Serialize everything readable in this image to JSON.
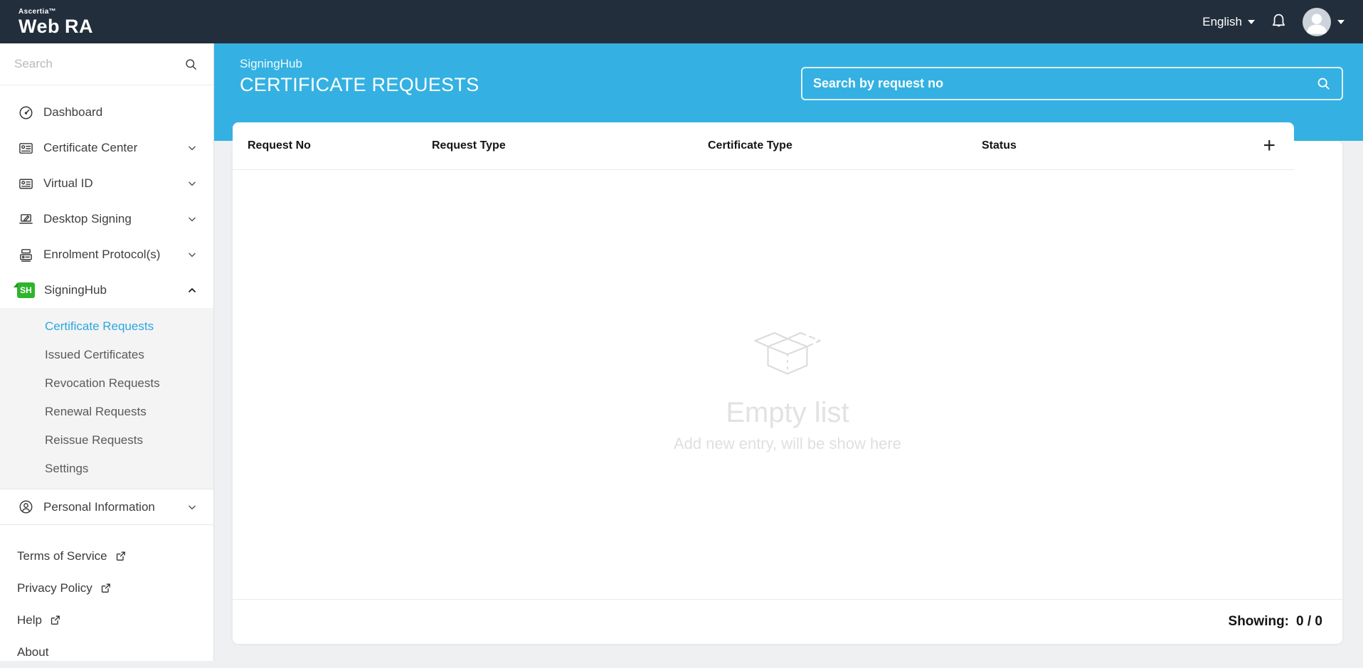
{
  "colors": {
    "topbar": "#222e3c",
    "accent_cyan": "#34b1e2",
    "active_link": "#2da7de",
    "signinghub_green": "#2eb52c"
  },
  "topbar": {
    "brand_small": "Ascertia™",
    "brand_large_1": "Web",
    "brand_large_2": "RA",
    "language_label": "English"
  },
  "sidebar": {
    "search_placeholder": "Search",
    "items": [
      {
        "label": "Dashboard"
      },
      {
        "label": "Certificate Center",
        "chevron": "down"
      },
      {
        "label": "Virtual ID",
        "chevron": "down"
      },
      {
        "label": "Desktop Signing",
        "chevron": "down"
      },
      {
        "label": "Enrolment Protocol(s)",
        "chevron": "down"
      },
      {
        "label": "SigningHub",
        "chevron": "up",
        "expanded": true
      },
      {
        "label": "Personal Information",
        "chevron": "down"
      }
    ],
    "signinghub_children": [
      "Certificate Requests",
      "Issued Certificates",
      "Revocation Requests",
      "Renewal Requests",
      "Reissue Requests",
      "Settings"
    ],
    "active_child": "Certificate Requests",
    "footer_links": [
      "Terms of Service",
      "Privacy Policy",
      "Help",
      "About"
    ]
  },
  "page_header": {
    "breadcrumb": "SigningHub",
    "title": "CERTIFICATE REQUESTS",
    "search_placeholder": "Search by request no"
  },
  "table": {
    "columns": [
      "Request No",
      "Request Type",
      "Certificate Type",
      "Status"
    ],
    "add_button": "+",
    "rows": []
  },
  "empty_state": {
    "title": "Empty list",
    "subtitle": "Add new entry, will be show here"
  },
  "footer": {
    "showing_label": "Showing:",
    "showing_value": "0 / 0"
  }
}
